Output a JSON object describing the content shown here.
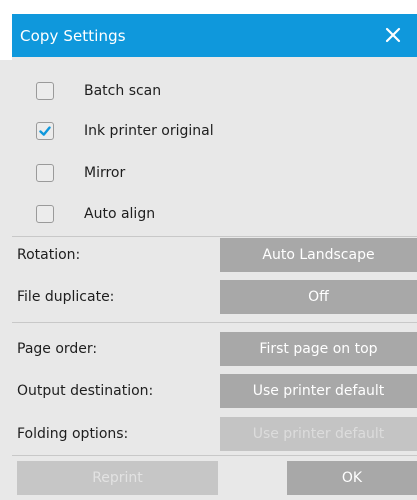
{
  "dialog": {
    "title": "Copy Settings"
  },
  "checkboxes": [
    {
      "label": "Batch scan",
      "checked": false
    },
    {
      "label": "Ink printer original",
      "checked": true
    },
    {
      "label": "Mirror",
      "checked": false
    },
    {
      "label": "Auto align",
      "checked": false
    }
  ],
  "fields": {
    "rotation": {
      "label": "Rotation:",
      "value": "Auto Landscape"
    },
    "file_duplicate": {
      "label": "File duplicate:",
      "value": "Off"
    },
    "page_order": {
      "label": "Page order:",
      "value": "First page on top"
    },
    "output_destination": {
      "label": "Output destination:",
      "value": "Use printer default"
    },
    "folding_options": {
      "label": "Folding options:",
      "value": "Use printer default",
      "disabled": true
    }
  },
  "buttons": {
    "reprint": {
      "label": "Reprint",
      "disabled": true
    },
    "ok": {
      "label": "OK"
    }
  },
  "colors": {
    "titlebar": "#0f98dc",
    "check_accent": "#0f98dc",
    "panel_bg": "#e8e8e8",
    "value_bg": "#a8a8a8"
  }
}
